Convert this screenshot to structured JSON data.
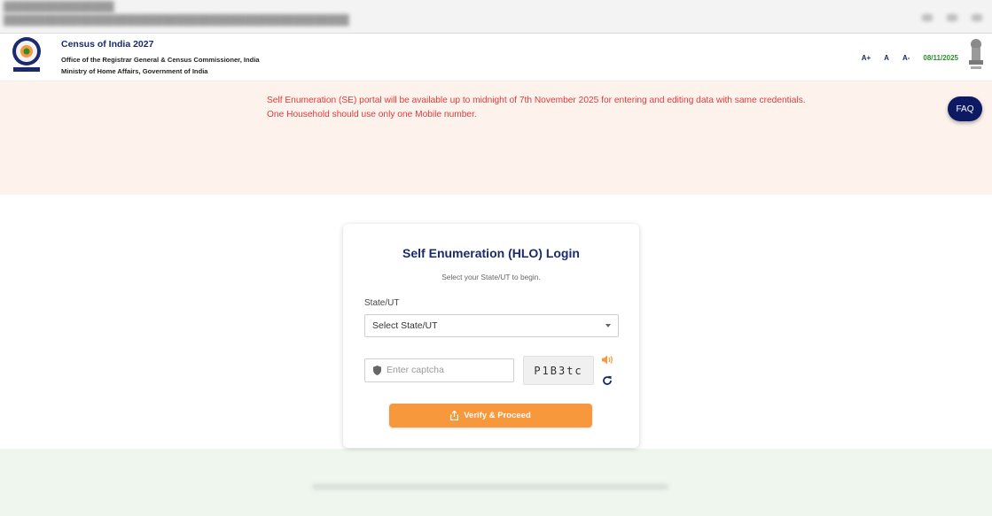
{
  "header": {
    "title": "Census of India 2027",
    "subtitle_line1": "Office of the Registrar General & Census Commissioner, India",
    "subtitle_line2": "Ministry of Home Affairs, Government of India",
    "font_controls": [
      "A+",
      "A",
      "A-"
    ],
    "date": "08/11/2025",
    "logo_icon": "census-logo-icon",
    "emblem_icon": "national-emblem-icon"
  },
  "notice": {
    "line1": "Self Enumeration (SE) portal will be available up to midnight of 7th November 2025 for entering and editing data with same credentials.",
    "line2": "One Household should use only one Mobile number."
  },
  "faq_label": "FAQ",
  "login": {
    "title": "Self Enumeration (HLO) Login",
    "subtitle": "Select your State/UT to begin.",
    "state_label": "State/UT",
    "state_selected": "Select State/UT",
    "captcha_placeholder": "Enter captcha",
    "captcha_code": "P1B3tc",
    "verify_label": "Verify & Proceed",
    "icons": [
      "shield-icon",
      "audio-icon",
      "refresh-icon",
      "share-icon",
      "chevron-down-icon"
    ]
  },
  "colors": {
    "brand_navy": "#1a2a6c",
    "notice_text": "#e03a3a",
    "notice_bg": "#fdf3ec",
    "date_green": "#2e8b2e",
    "button_orange": "#f7983c",
    "faq_bg": "#0d1a63",
    "footer_bg": "#eef6ee"
  }
}
